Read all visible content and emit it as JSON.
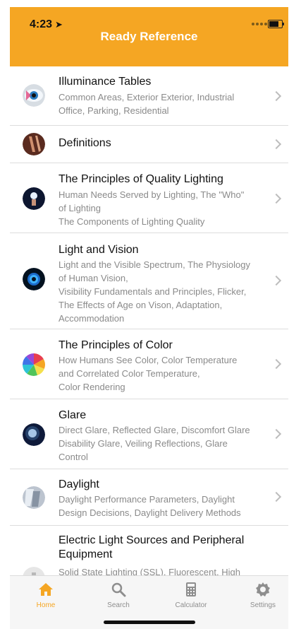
{
  "status_bar": {
    "time": "4:23"
  },
  "header": {
    "title": "Ready Reference"
  },
  "list": [
    {
      "title": "Illuminance Tables",
      "lines": [
        "Common Areas, Exterior Exterior, Industrial",
        "Office, Parking, Residential"
      ],
      "icon": "eye-icon"
    },
    {
      "title": "Definitions",
      "lines": [],
      "icon": "definitions-icon"
    },
    {
      "title": "The Principles of Quality Lighting",
      "lines": [
        "Human Needs Served by Lighting, The \"Who\"",
        "of Lighting",
        "The Components of Lighting Quality"
      ],
      "icon": "light-bulb-icon"
    },
    {
      "title": "Light and Vision",
      "lines": [
        "Light and the Visible Spectrum, The Physiology",
        "of Human Vision,",
        "Visibility Fundamentals and Principles, Flicker,",
        "The Effects of Age on Vison, Adaptation,",
        "Accommodation"
      ],
      "icon": "eye-blue-icon"
    },
    {
      "title": "The Principles of Color",
      "lines": [
        "How Humans See Color, Color Temperature",
        "and Correlated Color Temperature,",
        "Color Rendering"
      ],
      "icon": "color-wheel-icon"
    },
    {
      "title": "Glare",
      "lines": [
        "Direct Glare, Reflected Glare, Discomfort Glare",
        "Disability Glare, Veiling Reflections, Glare",
        "Control"
      ],
      "icon": "glare-icon"
    },
    {
      "title": "Daylight",
      "lines": [
        "Daylight Performance Parameters, Daylight",
        "Design Decisions, Daylight Delivery Methods"
      ],
      "icon": "daylight-icon"
    },
    {
      "title": "Electric Light Sources and Peripheral Equipment",
      "lines": [
        "Solid State Lighting (SSL), Fluorescent, High"
      ],
      "icon": "lamp-icon"
    }
  ],
  "tabbar": {
    "items": [
      {
        "label": "Home",
        "icon": "home-icon",
        "active": true
      },
      {
        "label": "Search",
        "icon": "search-icon",
        "active": false
      },
      {
        "label": "Calculator",
        "icon": "calculator-icon",
        "active": false
      },
      {
        "label": "Settings",
        "icon": "settings-icon",
        "active": false
      }
    ]
  },
  "colors": {
    "accent": "#f5a623",
    "header_text": "#ffffff",
    "title_text": "#111111",
    "subtitle_text": "#8a8a8a",
    "inactive_tab": "#8e8e8e"
  }
}
